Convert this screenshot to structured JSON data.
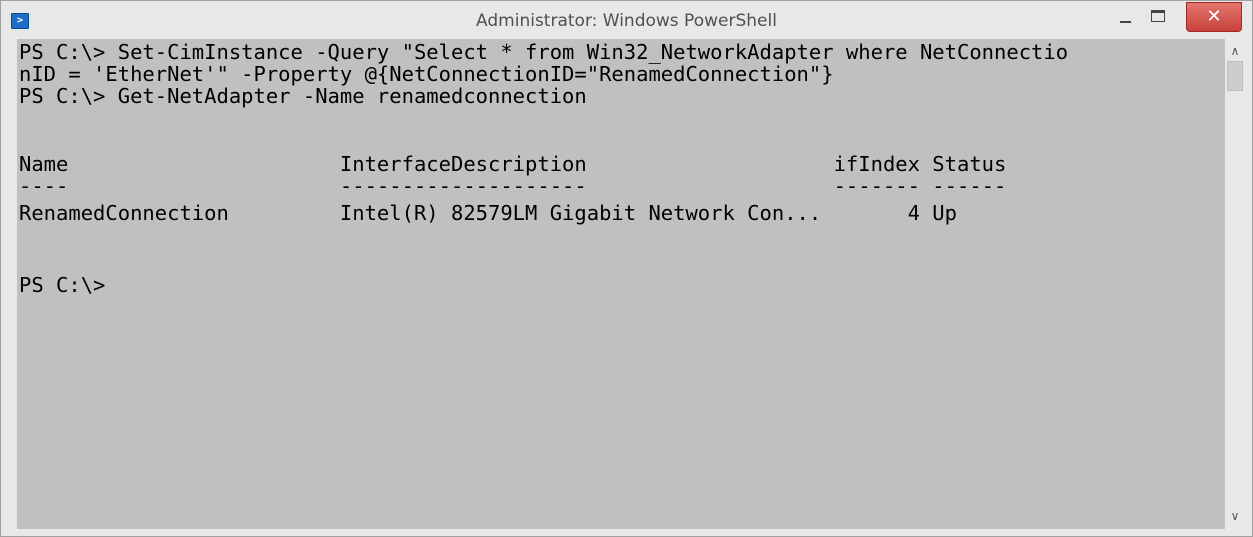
{
  "window": {
    "title": "Administrator: Windows PowerShell",
    "icon": "powershell-icon",
    "close_glyph": "✕"
  },
  "console": {
    "lines": [
      "PS C:\\> Set-CimInstance -Query \"Select * from Win32_NetworkAdapter where NetConnectio",
      "nID = 'EtherNet'\" -Property @{NetConnectionID=\"RenamedConnection\"}",
      "PS C:\\> Get-NetAdapter -Name renamedconnection",
      "",
      "Name                      InterfaceDescription                    ifIndex Status",
      "----                      --------------------                    ------- ------",
      "RenamedConnection         Intel(R) 82579LM Gigabit Network Con...       4 Up",
      "",
      "",
      "PS C:\\>"
    ],
    "background": "#c0c0c0",
    "foreground": "#000000"
  },
  "scrollbar": {
    "up_glyph": "∧",
    "down_glyph": "∨"
  }
}
